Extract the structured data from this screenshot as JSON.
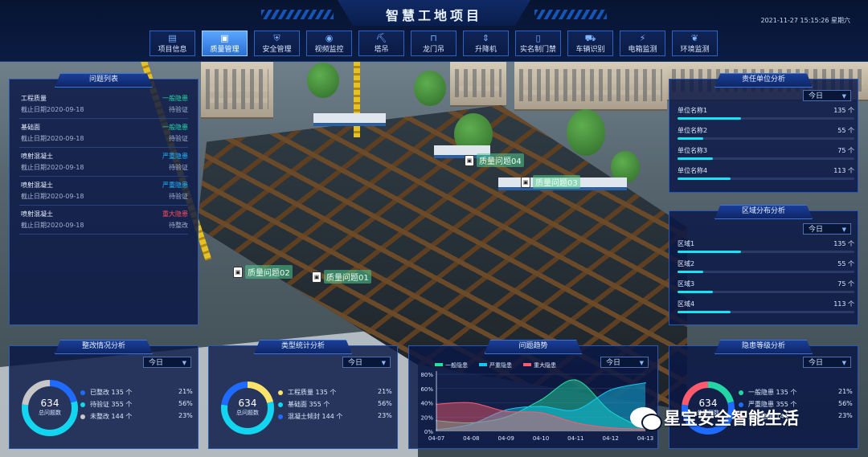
{
  "header": {
    "title": "智慧工地项目",
    "datetime": "2021-11-27 15:15:26 星期六"
  },
  "nav": [
    {
      "label": "项目信息",
      "icon": "document-icon",
      "glyph": "▤"
    },
    {
      "label": "质量管理",
      "icon": "quality-icon",
      "glyph": "▣",
      "active": true
    },
    {
      "label": "安全管理",
      "icon": "shield-icon",
      "glyph": "⛨"
    },
    {
      "label": "视频监控",
      "icon": "camera-icon",
      "glyph": "◉"
    },
    {
      "label": "塔吊",
      "icon": "tower-crane-icon",
      "glyph": "⛏"
    },
    {
      "label": "龙门吊",
      "icon": "gantry-crane-icon",
      "glyph": "⊓"
    },
    {
      "label": "升降机",
      "icon": "elevator-icon",
      "glyph": "⇕"
    },
    {
      "label": "实名制门禁",
      "icon": "gate-icon",
      "glyph": "▯"
    },
    {
      "label": "车辆识别",
      "icon": "car-icon",
      "glyph": "⛟"
    },
    {
      "label": "电箱监测",
      "icon": "power-box-icon",
      "glyph": "⚡"
    },
    {
      "label": "环境监测",
      "icon": "leaf-icon",
      "glyph": "❦"
    }
  ],
  "issues": {
    "title": "问题列表",
    "items": [
      {
        "title": "工程质量",
        "date": "截止日期2020-09-18",
        "level": "一般隐患",
        "level_color": "#22d6a5",
        "status": "待验证"
      },
      {
        "title": "基础面",
        "date": "截止日期2020-09-18",
        "level": "一般隐患",
        "level_color": "#22d6a5",
        "status": "待验证"
      },
      {
        "title": "喷射混凝土",
        "date": "截止日期2020-09-18",
        "level": "严重隐患",
        "level_color": "#1fb8ff",
        "status": "待验证"
      },
      {
        "title": "喷射混凝土",
        "date": "截止日期2020-09-18",
        "level": "严重隐患",
        "level_color": "#1fb8ff",
        "status": "待验证"
      },
      {
        "title": "喷射混凝土",
        "date": "截止日期2020-09-18",
        "level": "重大隐患",
        "level_color": "#ff4b5c",
        "status": "待整改"
      }
    ]
  },
  "responsible": {
    "title": "责任单位分析",
    "period": "今日",
    "max": 135,
    "items": [
      {
        "name": "单位名称1",
        "value": 135,
        "unit": "个"
      },
      {
        "name": "单位名称2",
        "value": 55,
        "unit": "个"
      },
      {
        "name": "单位名称3",
        "value": 75,
        "unit": "个"
      },
      {
        "name": "单位名称4",
        "value": 113,
        "unit": "个"
      }
    ]
  },
  "regions": {
    "title": "区域分布分析",
    "period": "今日",
    "max": 135,
    "items": [
      {
        "name": "区域1",
        "value": 135,
        "unit": "个"
      },
      {
        "name": "区域2",
        "value": 55,
        "unit": "个"
      },
      {
        "name": "区域3",
        "value": 75,
        "unit": "个"
      },
      {
        "name": "区域4",
        "value": 113,
        "unit": "个"
      }
    ]
  },
  "rectify": {
    "title": "整改情况分析",
    "period": "今日",
    "total": "634",
    "total_label": "总问题数",
    "items": [
      {
        "label": "已整改 135 个",
        "pct": "21%",
        "value": 21,
        "color": "#1f6bff"
      },
      {
        "label": "待验证 355 个",
        "pct": "56%",
        "value": 56,
        "color": "#12d6f0"
      },
      {
        "label": "未整改 144 个",
        "pct": "23%",
        "value": 23,
        "color": "#c7c7c7"
      }
    ]
  },
  "types": {
    "title": "类型统计分析",
    "period": "今日",
    "total": "634",
    "total_label": "总问题数",
    "items": [
      {
        "label": "工程质量 135 个",
        "pct": "21%",
        "value": 21,
        "color": "#ffe46b"
      },
      {
        "label": "基础面 355 个",
        "pct": "56%",
        "value": 56,
        "color": "#12d6f0"
      },
      {
        "label": "混凝土倾封 144 个",
        "pct": "23%",
        "value": 23,
        "color": "#1f6bff"
      }
    ]
  },
  "trend": {
    "title": "问题趋势",
    "period": "今日",
    "chart_data": {
      "type": "area",
      "x": [
        "04-07",
        "04-08",
        "04-09",
        "04-10",
        "04-11",
        "04-12",
        "04-13"
      ],
      "ylim": [
        0,
        80
      ],
      "yticks": [
        "0%",
        "20%",
        "40%",
        "60%",
        "80%"
      ],
      "series": [
        {
          "name": "一般隐患",
          "color": "#22e3a4",
          "values": [
            15,
            12,
            20,
            44,
            72,
            28,
            3
          ]
        },
        {
          "name": "严重隐患",
          "color": "#12c9f0",
          "values": [
            2,
            10,
            30,
            35,
            30,
            58,
            68
          ]
        },
        {
          "name": "重大隐患",
          "color": "#ff5a6e",
          "values": [
            38,
            40,
            28,
            26,
            12,
            5,
            3
          ]
        }
      ]
    }
  },
  "level": {
    "title": "隐患等级分析",
    "period": "今日",
    "total": "634",
    "total_label": "总问题数",
    "items": [
      {
        "label": "一般隐患 135 个",
        "pct": "21%",
        "value": 21,
        "color": "#22d6a5"
      },
      {
        "label": "严重隐患 355 个",
        "pct": "56%",
        "value": 56,
        "color": "#1f6bff"
      },
      {
        "label": "重大隐患 144 个",
        "pct": "23%",
        "value": 23,
        "color": "#ff5a6e"
      }
    ]
  },
  "markers": [
    "质量问题04",
    "质量问题03",
    "质量问题02",
    "质量问题01"
  ],
  "watermark": "星宝安全智能生活"
}
